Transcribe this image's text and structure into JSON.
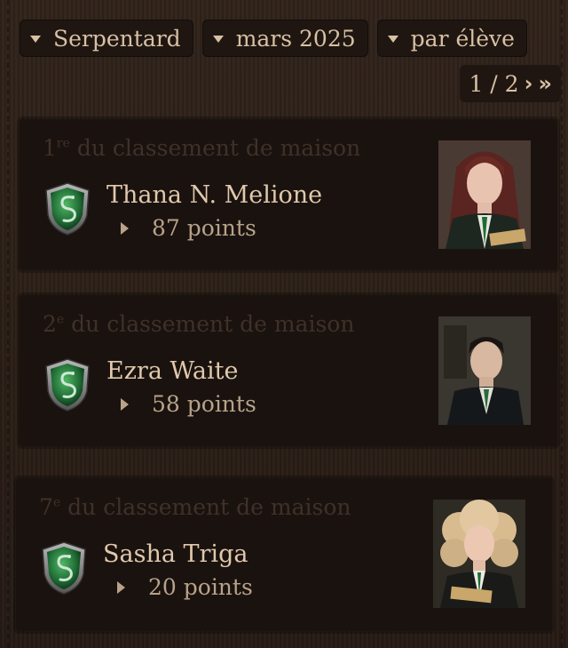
{
  "filters": {
    "house": "Serpentard",
    "month": "mars 2025",
    "mode": "par élève"
  },
  "pager": {
    "page": "1 / 2"
  },
  "cards": [
    {
      "rank_num": "1",
      "rank_sup": "re",
      "rank_text": " du classement de maison",
      "name": "Thana N. Melione",
      "points": "87 points",
      "portrait_icon": "female-student-portrait"
    },
    {
      "rank_num": "2",
      "rank_sup": "e",
      "rank_text": " du classement de maison",
      "name": "Ezra Waite",
      "points": "58 points",
      "portrait_icon": "male-student-portrait"
    },
    {
      "rank_num": "7",
      "rank_sup": "e",
      "rank_text": " du classement de maison",
      "name": "Sasha Triga",
      "points": "20 points",
      "portrait_icon": "blonde-student-portrait"
    }
  ],
  "colors": {
    "background": "#2a1e16",
    "card": "#1a120e",
    "text": "#d8c0a4",
    "crest_green": "#2e8a46"
  }
}
